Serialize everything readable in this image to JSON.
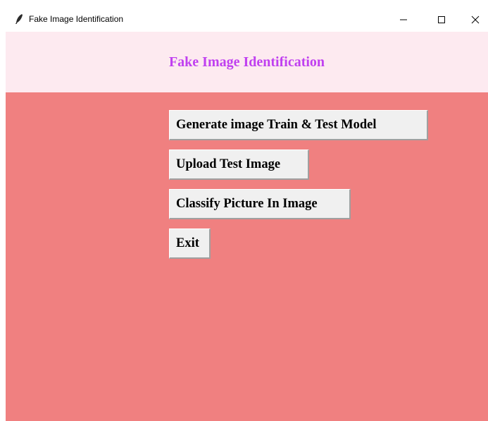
{
  "window": {
    "title": "Fake Image Identification",
    "background_color": "#f08080",
    "controls": {
      "minimize_icon": "minimize-icon",
      "maximize_icon": "maximize-icon",
      "close_icon": "close-icon"
    }
  },
  "header": {
    "title": "Fake Image Identification",
    "background_color": "#fdeaf0",
    "title_color": "#c040f0"
  },
  "buttons": {
    "generate_label": "Generate image Train & Test Model",
    "upload_label": "Upload Test Image",
    "classify_label": "Classify Picture In Image",
    "exit_label": "Exit"
  }
}
